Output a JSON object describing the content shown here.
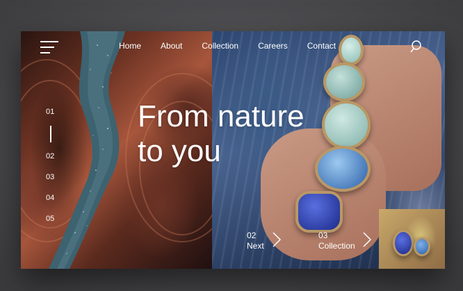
{
  "nav": {
    "menu_icon": "hamburger-menu-icon",
    "items": [
      "Home",
      "About",
      "Collection",
      "Careers",
      "Contact"
    ],
    "search_icon": "search-icon"
  },
  "hero": {
    "line1": "From nature",
    "line2": "to you"
  },
  "pager": {
    "active": "01",
    "items": [
      "02",
      "03",
      "04",
      "05"
    ]
  },
  "steps": {
    "next": {
      "num": "02",
      "label": "Next"
    },
    "collection": {
      "num": "03",
      "label": "Collection"
    }
  },
  "colors": {
    "text": "#ffffff",
    "stone_frame": "#b99866"
  }
}
